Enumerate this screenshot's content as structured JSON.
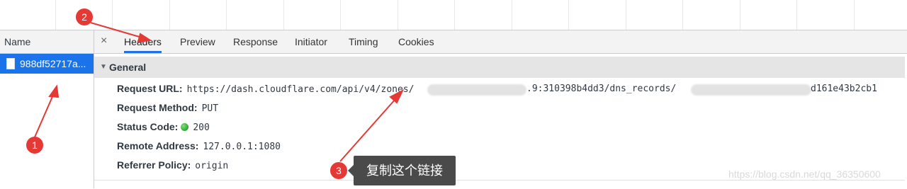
{
  "name_panel": {
    "header": "Name",
    "request_name": "988df52717a..."
  },
  "tabs": [
    {
      "label": "Headers",
      "active": true
    },
    {
      "label": "Preview"
    },
    {
      "label": "Response"
    },
    {
      "label": "Initiator"
    },
    {
      "label": "Timing"
    },
    {
      "label": "Cookies"
    }
  ],
  "close_glyph": "×",
  "general": {
    "title": "General",
    "rows": [
      {
        "key": "Request URL:",
        "value_a": "https://dash.cloudflare.com/api/v4/zones/",
        "value_b": ".9:310398b4dd3/dns_records/",
        "value_c": "d161e43b2cb1"
      },
      {
        "key": "Request Method:",
        "value": "PUT"
      },
      {
        "key": "Status Code:",
        "value": "200"
      },
      {
        "key": "Remote Address:",
        "value": "127.0.0.1:1080"
      },
      {
        "key": "Referrer Policy:",
        "value": "origin"
      }
    ]
  },
  "annotations": {
    "badge_1": "1",
    "badge_2": "2",
    "badge_3": "3",
    "tooltip": "复制这个链接",
    "color": "#e53935"
  },
  "watermark": "https://blog.csdn.net/qq_36350600"
}
